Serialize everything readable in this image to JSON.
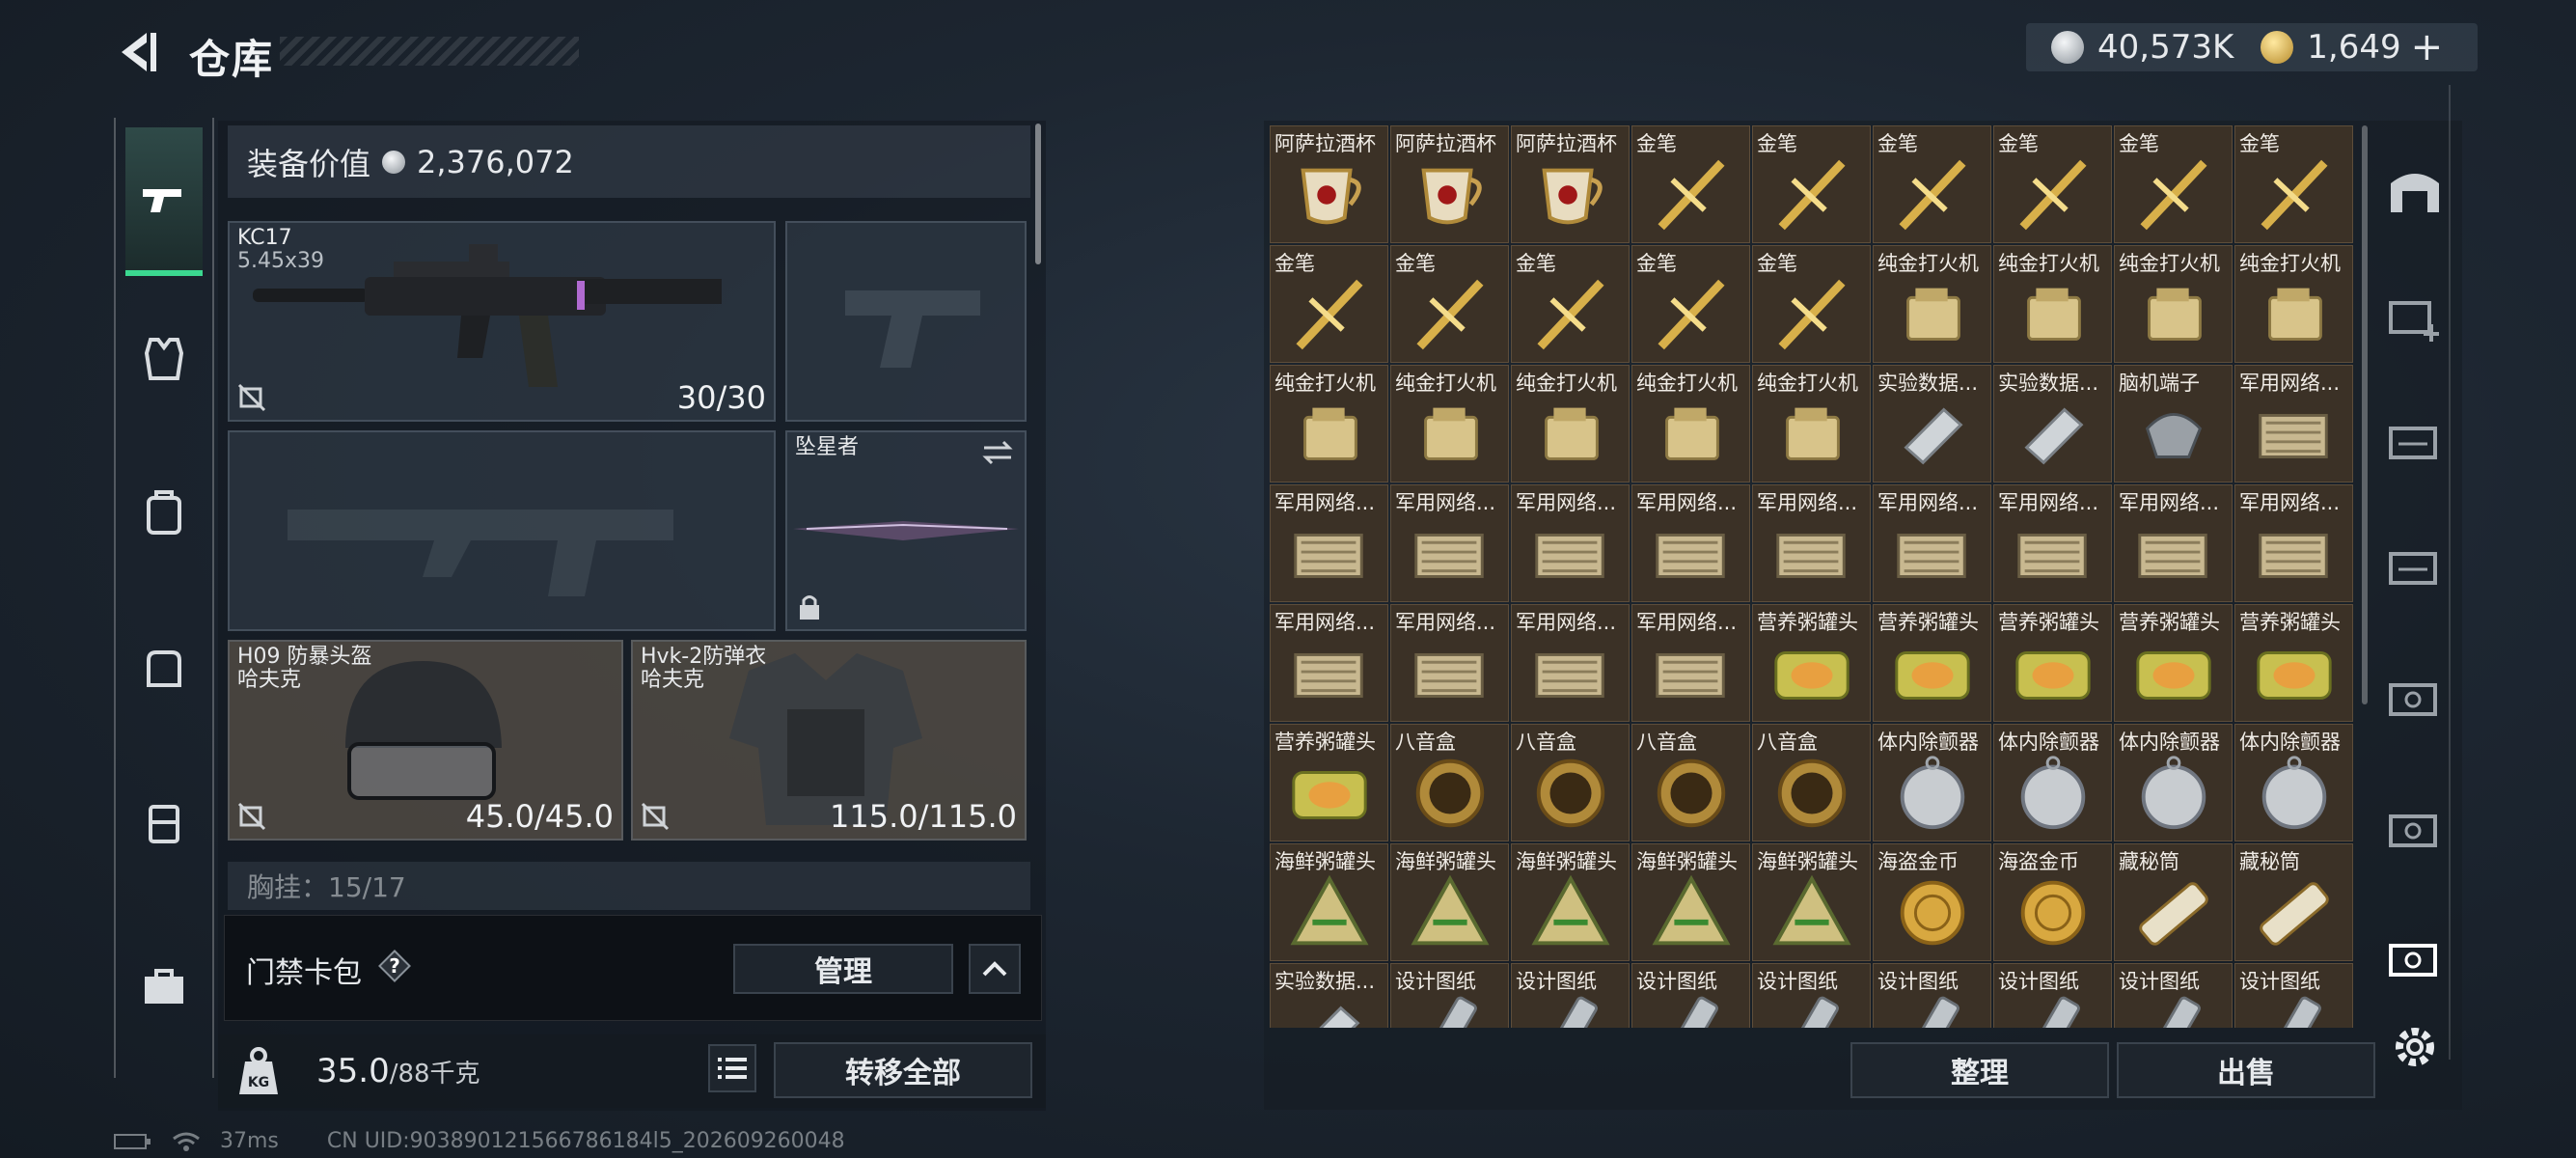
{
  "header": {
    "title": "仓库",
    "currency_silver": "40,573K",
    "currency_gold": "1,649",
    "add_label": "+"
  },
  "left_panel": {
    "equip_value_label": "装备价值",
    "equip_value": "2,376,072",
    "primary_weapon": {
      "name": "KC17",
      "caliber": "5.45x39",
      "ammo": "30/30"
    },
    "melee": {
      "name": "坠星者"
    },
    "helmet": {
      "name": "H09 防暴头盔",
      "brand": "哈夫克",
      "durability": "45.0/45.0"
    },
    "armor": {
      "name": "Hvk-2防弹衣",
      "brand": "哈夫克",
      "durability": "115.0/115.0"
    },
    "chest_rig": "胸挂：15/17",
    "card_label": "门禁卡包",
    "help_label": "?",
    "manage_label": "管理",
    "weight_current": "35.0",
    "weight_cap": "/88千克",
    "kg_label": "KG",
    "transfer_all_label": "转移全部"
  },
  "status_bar": {
    "ping": "37ms",
    "uid": "CN UID:903890121566786184l5_202609260048"
  },
  "grid": {
    "rows": [
      [
        "阿萨拉酒杯",
        "阿萨拉酒杯",
        "阿萨拉酒杯",
        "金笔",
        "金笔",
        "金笔",
        "金笔",
        "金笔",
        "金笔"
      ],
      [
        "金笔",
        "金笔",
        "金笔",
        "金笔",
        "金笔",
        "纯金打火机",
        "纯金打火机",
        "纯金打火机",
        "纯金打火机"
      ],
      [
        "纯金打火机",
        "纯金打火机",
        "纯金打火机",
        "纯金打火机",
        "纯金打火机",
        "实验数据...",
        "实验数据...",
        "脑机端子",
        "军用网络..."
      ],
      [
        "军用网络...",
        "军用网络...",
        "军用网络...",
        "军用网络...",
        "军用网络...",
        "军用网络...",
        "军用网络...",
        "军用网络...",
        "军用网络..."
      ],
      [
        "军用网络...",
        "军用网络...",
        "军用网络...",
        "军用网络...",
        "营养粥罐头",
        "营养粥罐头",
        "营养粥罐头",
        "营养粥罐头",
        "营养粥罐头"
      ],
      [
        "营养粥罐头",
        "八音盒",
        "八音盒",
        "八音盒",
        "八音盒",
        "体内除颤器",
        "体内除颤器",
        "体内除颤器",
        "体内除颤器"
      ],
      [
        "海鲜粥罐头",
        "海鲜粥罐头",
        "海鲜粥罐头",
        "海鲜粥罐头",
        "海鲜粥罐头",
        "海盗金币",
        "海盗金币",
        "藏秘筒",
        "藏秘筒"
      ],
      [
        "实验数据...",
        "设计图纸",
        "设计图纸",
        "设计图纸",
        "设计图纸",
        "设计图纸",
        "设计图纸",
        "设计图纸",
        "设计图纸"
      ]
    ]
  },
  "buttons": {
    "organize": "整理",
    "sell": "出售"
  },
  "icons": {
    "left_nav": [
      "pistol-icon",
      "vest-icon",
      "backpack-icon",
      "bag-icon",
      "case-icon",
      "toolbox-icon"
    ],
    "right_nav": [
      "safehouse-icon",
      "add-storage-icon",
      "storage-icon-1",
      "storage-icon-2",
      "storage-icon-3",
      "storage-icon-4",
      "storage-icon-5",
      "settings-icon"
    ]
  },
  "colors": {
    "cell_bg": "#3b3126",
    "accent_green": "#3bd890",
    "gold": "#d8b04a"
  }
}
